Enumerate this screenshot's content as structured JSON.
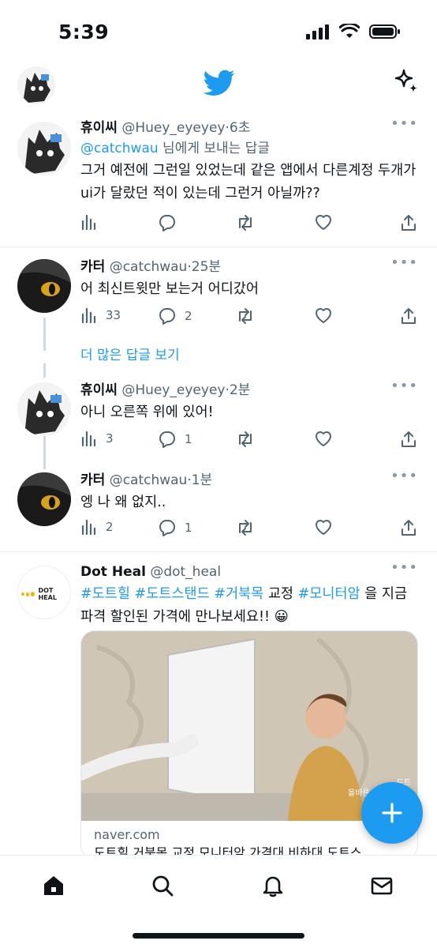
{
  "status": {
    "time": "5:39"
  },
  "colors": {
    "accent": "#1d9bf0",
    "text": "#0f1419",
    "muted": "#536471"
  },
  "icons": {
    "logo": "twitter-bird-icon",
    "sparkle": "sparkle-icon",
    "views": "views-icon",
    "reply": "reply-icon",
    "retweet": "retweet-icon",
    "like": "like-icon",
    "share": "share-icon",
    "compose": "plus-icon"
  },
  "tweets": [
    {
      "name": "휴이씨",
      "handle": "@Huey_eyeyey",
      "time": "6초",
      "reply_to": {
        "user": "@catchwau",
        "suffix": " 님에게 보내는 답글"
      },
      "text": "그거 예전에 그런일 있었는데 같은 앱에서 다른계정 두개가 ui가 달랐던 적이 있는데 그런거 아닐까??",
      "views": "",
      "replies": "",
      "likes": ""
    },
    {
      "name": "카터",
      "handle": "@catchwau",
      "time": "25분",
      "text": "어 최신트윗만 보는거 어디갔어",
      "views": "33",
      "replies": "2"
    },
    {
      "name": "휴이씨",
      "handle": "@Huey_eyeyey",
      "time": "2분",
      "text": "아니 오른쪽 위에 있어!",
      "views": "3",
      "replies": "1"
    },
    {
      "name": "카터",
      "handle": "@catchwau",
      "time": "1분",
      "text": "엥 나 왜 없지..",
      "views": "2",
      "replies": "1"
    }
  ],
  "show_more_replies": "더 많은 답글 보기",
  "ad": {
    "name": "Dot Heal",
    "handle": "@dot_heal",
    "logo_text": "DOT HEAL",
    "text_parts": [
      "#도트힐",
      " ",
      "#도트스탠드",
      " ",
      "#거북목",
      " 교정 ",
      "#모니터암",
      " 을 지금 파격 할인된 가격에 만나보세요!! 😀"
    ],
    "card_overlay": "도트\n올바른 자세를 만들",
    "card_domain": "naver.com",
    "card_title": "도트힐 거북목 교정 모니터암 가격대 비하대 도트스"
  }
}
